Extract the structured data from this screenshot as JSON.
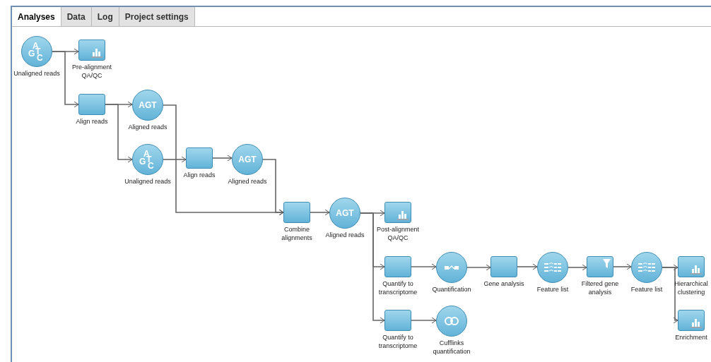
{
  "tabs": [
    {
      "label": "Analyses",
      "selected": true
    },
    {
      "label": "Data",
      "selected": false
    },
    {
      "label": "Log",
      "selected": false
    },
    {
      "label": "Project settings",
      "selected": false
    }
  ],
  "nodes": [
    {
      "kind": "unaligned",
      "letters": [
        "A",
        "G",
        "T",
        "C"
      ],
      "label": "Unaligned reads"
    },
    {
      "kind": "report",
      "label": "Pre-alignment\nQA/QC"
    },
    {
      "kind": "task",
      "label": "Align reads"
    },
    {
      "kind": "aligned",
      "letters": [
        "AGT"
      ],
      "label": "Aligned reads"
    },
    {
      "kind": "unaligned",
      "letters": [
        "A",
        "G",
        "T",
        "C"
      ],
      "label": "Unaligned reads"
    },
    {
      "kind": "task",
      "label": "Align reads"
    },
    {
      "kind": "aligned",
      "letters": [
        "AGT"
      ],
      "label": "Aligned reads"
    },
    {
      "kind": "task",
      "label": "Combine\nalignments"
    },
    {
      "kind": "aligned",
      "letters": [
        "AGT"
      ],
      "label": "Aligned reads"
    },
    {
      "kind": "report",
      "label": "Post-alignment\nQA/QC"
    },
    {
      "kind": "task",
      "label": "Quantify to\ntranscriptome"
    },
    {
      "kind": "quant",
      "label": "Quantification"
    },
    {
      "kind": "task",
      "label": "Gene analysis"
    },
    {
      "kind": "features",
      "label": "Feature list"
    },
    {
      "kind": "filter",
      "label": "Filtered gene\nanalysis"
    },
    {
      "kind": "features",
      "label": "Feature list"
    },
    {
      "kind": "report",
      "label": "Hierarchical\nclustering"
    },
    {
      "kind": "report",
      "label": "Enrichment"
    },
    {
      "kind": "task",
      "label": "Quantify to\ntranscriptome"
    },
    {
      "kind": "link",
      "label": "Cufflinks\nquantification"
    }
  ]
}
